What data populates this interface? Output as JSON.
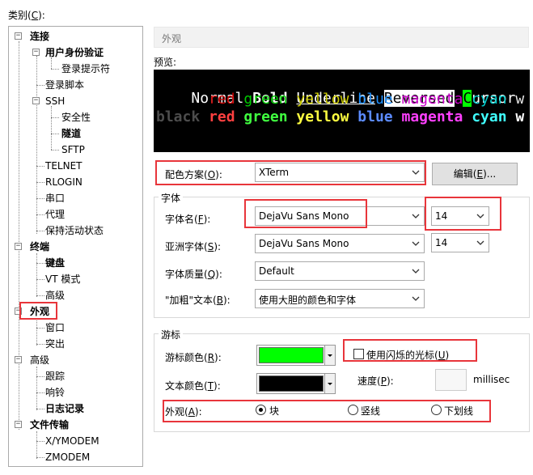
{
  "category_label": "类别(C):",
  "category_hotkey": "C",
  "tree": {
    "connection": "连接",
    "user_auth": "用户身份验证",
    "login_prompt": "登录提示符",
    "login_script": "登录脚本",
    "ssh": "SSH",
    "security": "安全性",
    "tunnel": "隧道",
    "sftp": "SFTP",
    "telnet": "TELNET",
    "rlogin": "RLOGIN",
    "serial": "串口",
    "proxy": "代理",
    "keepalive": "保持活动状态",
    "terminal": "终端",
    "keyboard": "键盘",
    "vt_mode": "VT 模式",
    "advanced1": "高级",
    "appearance": "外观",
    "window": "窗口",
    "highlight": "突出",
    "advanced2": "高级",
    "tracking": "跟踪",
    "bell": "响铃",
    "logging": "日志记录",
    "file_transfer": "文件传输",
    "xymodem": "X/YMODEM",
    "zmodem": "ZMODEM"
  },
  "header_title": "外观",
  "preview_label": "预览:",
  "preview": {
    "normal": "Normal",
    "bold": "Bold",
    "underline": "Underline",
    "reversed": "Reversed",
    "cursor_char": "C",
    "cursor_rest": "ursor",
    "colors": [
      "red",
      "green",
      "yellow",
      "blue",
      "magenta",
      "cyan",
      "w"
    ],
    "black": "black"
  },
  "scheme": {
    "label": "配色方案(O):",
    "value": "XTerm",
    "edit_button": "编辑(E)..."
  },
  "font_group": {
    "title": "字体",
    "font_name_label": "字体名(F):",
    "font_name_value": "DejaVu Sans Mono",
    "font_size_value": "14",
    "asian_font_label": "亚洲字体(S):",
    "asian_font_value": "DejaVu Sans Mono",
    "asian_size_value": "14",
    "quality_label": "字体质量(Q):",
    "quality_value": "Default",
    "bold_label": "\"加粗\"文本(B):",
    "bold_value": "使用大胆的颜色和字体"
  },
  "cursor_group": {
    "title": "游标",
    "cursor_color_label": "游标颜色(R):",
    "cursor_color": "#00ff00",
    "blink_label": "使用闪烁的光标(U)",
    "text_color_label": "文本颜色(T):",
    "text_color": "#000000",
    "speed_label": "速度(P):",
    "speed_unit": "millisec",
    "shape_label": "外观(A):",
    "shape_block": "块",
    "shape_vline": "竖线",
    "shape_underline": "下划线"
  },
  "colors": {
    "red": "#e8353b",
    "dim_red": "#cd0000",
    "dim_green": "#00cd00",
    "dim_yellow": "#cdcd00",
    "dim_blue": "#1e90ff",
    "dim_magenta": "#cd00cd",
    "dim_cyan": "#00cdcd",
    "bright_red": "#ff4040",
    "bright_green": "#40ff40",
    "bright_yellow": "#ffff40",
    "bright_blue": "#5c8cff",
    "bright_magenta": "#ff40ff",
    "bright_cyan": "#40ffff"
  }
}
